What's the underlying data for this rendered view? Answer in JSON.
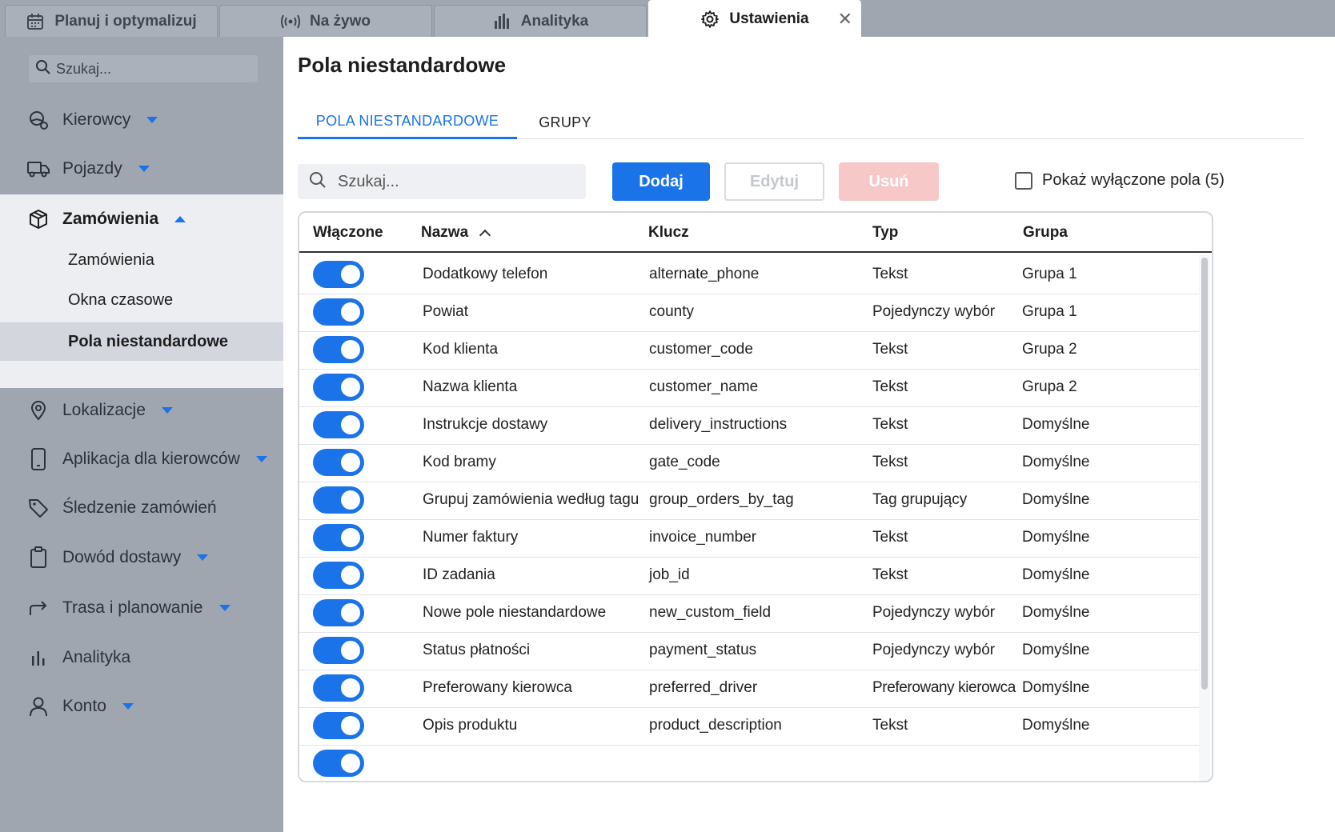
{
  "tabs": [
    {
      "label": "Planuj i optymalizuj",
      "icon": "calendar-icon"
    },
    {
      "label": "Na żywo",
      "icon": "live-broadcast-icon"
    },
    {
      "label": "Analityka",
      "icon": "bar-chart-icon"
    },
    {
      "label": "Ustawienia",
      "icon": "gear-icon",
      "active": true
    }
  ],
  "sidebar": {
    "search_placeholder": "Szukaj...",
    "items": [
      {
        "label": "Kierowcy",
        "icon": "drivers-icon"
      },
      {
        "label": "Pojazdy",
        "icon": "truck-icon"
      },
      {
        "label": "Zamówienia",
        "icon": "package-icon",
        "expanded": true
      },
      {
        "label": "Lokalizacje",
        "icon": "location-pin-icon"
      },
      {
        "label": "Aplikacja dla kierowców",
        "icon": "phone-icon"
      },
      {
        "label": "Śledzenie zamówień",
        "icon": "tag-icon"
      },
      {
        "label": "Dowód dostawy",
        "icon": "clipboard-icon"
      },
      {
        "label": "Trasa i planowanie",
        "icon": "route-arrow-icon"
      },
      {
        "label": "Analityka",
        "icon": "bar-chart-icon"
      },
      {
        "label": "Konto",
        "icon": "user-icon"
      }
    ],
    "subitems": [
      "Zamówienia",
      "Okna czasowe",
      "Pola niestandardowe"
    ]
  },
  "main": {
    "title": "Pola niestandardowe",
    "tabs": [
      "POLA NIESTANDARDOWE",
      "GRUPY"
    ],
    "search_placeholder": "Szukaj...",
    "buttons": {
      "add": "Dodaj",
      "edit": "Edytuj",
      "delete": "Usuń"
    },
    "show_disabled_label": "Pokaż wyłączone pola (5)",
    "show_disabled_checked": false
  },
  "table": {
    "columns": [
      "Włączone",
      "Nazwa",
      "Klucz",
      "Typ",
      "Grupa"
    ],
    "sort_column": "Nazwa",
    "sort_direction": "ascending",
    "rows": [
      {
        "enabled": true,
        "name": "Dodatkowy telefon",
        "key": "alternate_phone",
        "type": "Tekst",
        "group": "Grupa 1"
      },
      {
        "enabled": true,
        "name": "Powiat",
        "key": "county",
        "type": "Pojedynczy wybór",
        "group": "Grupa 1"
      },
      {
        "enabled": true,
        "name": "Kod klienta",
        "key": "customer_code",
        "type": "Tekst",
        "group": "Grupa 2"
      },
      {
        "enabled": true,
        "name": "Nazwa klienta",
        "key": "customer_name",
        "type": "Tekst",
        "group": "Grupa 2"
      },
      {
        "enabled": true,
        "name": "Instrukcje dostawy",
        "key": "delivery_instructions",
        "type": "Tekst",
        "group": "Domyślne"
      },
      {
        "enabled": true,
        "name": "Kod bramy",
        "key": "gate_code",
        "type": "Tekst",
        "group": "Domyślne"
      },
      {
        "enabled": true,
        "name": "Grupuj zamówienia według tagu",
        "key": "group_orders_by_tag",
        "type": "Tag grupujący",
        "group": "Domyślne"
      },
      {
        "enabled": true,
        "name": "Numer faktury",
        "key": "invoice_number",
        "type": "Tekst",
        "group": "Domyślne"
      },
      {
        "enabled": true,
        "name": "ID zadania",
        "key": "job_id",
        "type": "Tekst",
        "group": "Domyślne"
      },
      {
        "enabled": true,
        "name": "Nowe pole niestandardowe",
        "key": "new_custom_field",
        "type": "Pojedynczy wybór",
        "group": "Domyślne"
      },
      {
        "enabled": true,
        "name": "Status płatności",
        "key": "payment_status",
        "type": "Pojedynczy wybór",
        "group": "Domyślne"
      },
      {
        "enabled": true,
        "name": "Preferowany kierowca",
        "key": "preferred_driver",
        "type": "Preferowany kierowca",
        "group": "Domyślne"
      },
      {
        "enabled": true,
        "name": "Opis produktu",
        "key": "product_description",
        "type": "Tekst",
        "group": "Domyślne"
      },
      {
        "enabled": true,
        "name": "",
        "key": "",
        "type": "",
        "group": ""
      }
    ]
  },
  "colors": {
    "accent": "#1a73e8",
    "sidebar_bg": "#9fa6b0",
    "danger_disabled": "#f6c8c8"
  }
}
